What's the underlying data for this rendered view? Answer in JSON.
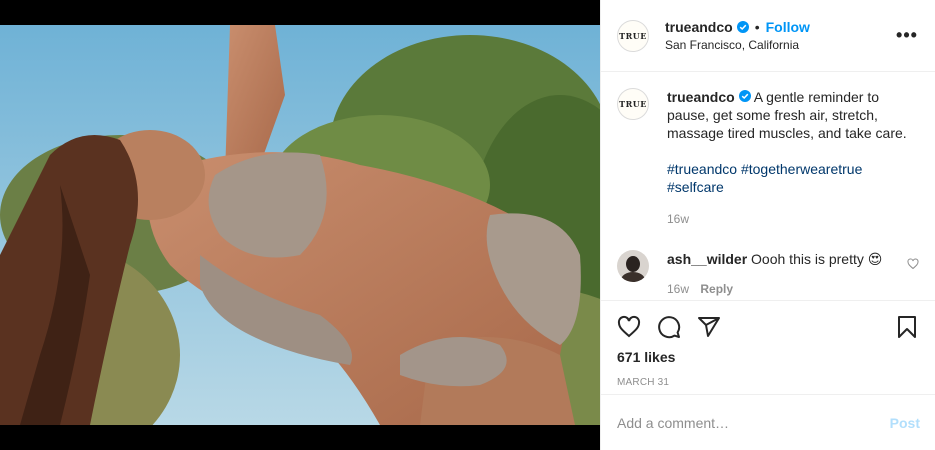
{
  "post": {
    "header": {
      "logo_text": "TRUE",
      "username": "trueandco",
      "separator": "•",
      "follow_label": "Follow",
      "location": "San Francisco, California",
      "more_label": "•••"
    },
    "caption": {
      "username": "trueandco",
      "text": "A gentle reminder to pause, get some fresh air, stretch, massage tired muscles, and take care.",
      "hashtags": [
        "#trueandco",
        "#togetherwearetrue",
        "#selfcare"
      ],
      "time": "16w"
    },
    "comments": [
      {
        "username": "ash__wilder",
        "text": "Oooh this is pretty 😍",
        "time": "16w",
        "reply_label": "Reply"
      }
    ],
    "likes": "671 likes",
    "date": "MARCH 31",
    "add_comment": {
      "placeholder": "Add a comment…",
      "post_label": "Post"
    },
    "colors": {
      "accent": "#0095f6",
      "hashtag": "#00376b",
      "muted": "#8e8e8e",
      "post_disabled": "#b2dffc"
    }
  }
}
